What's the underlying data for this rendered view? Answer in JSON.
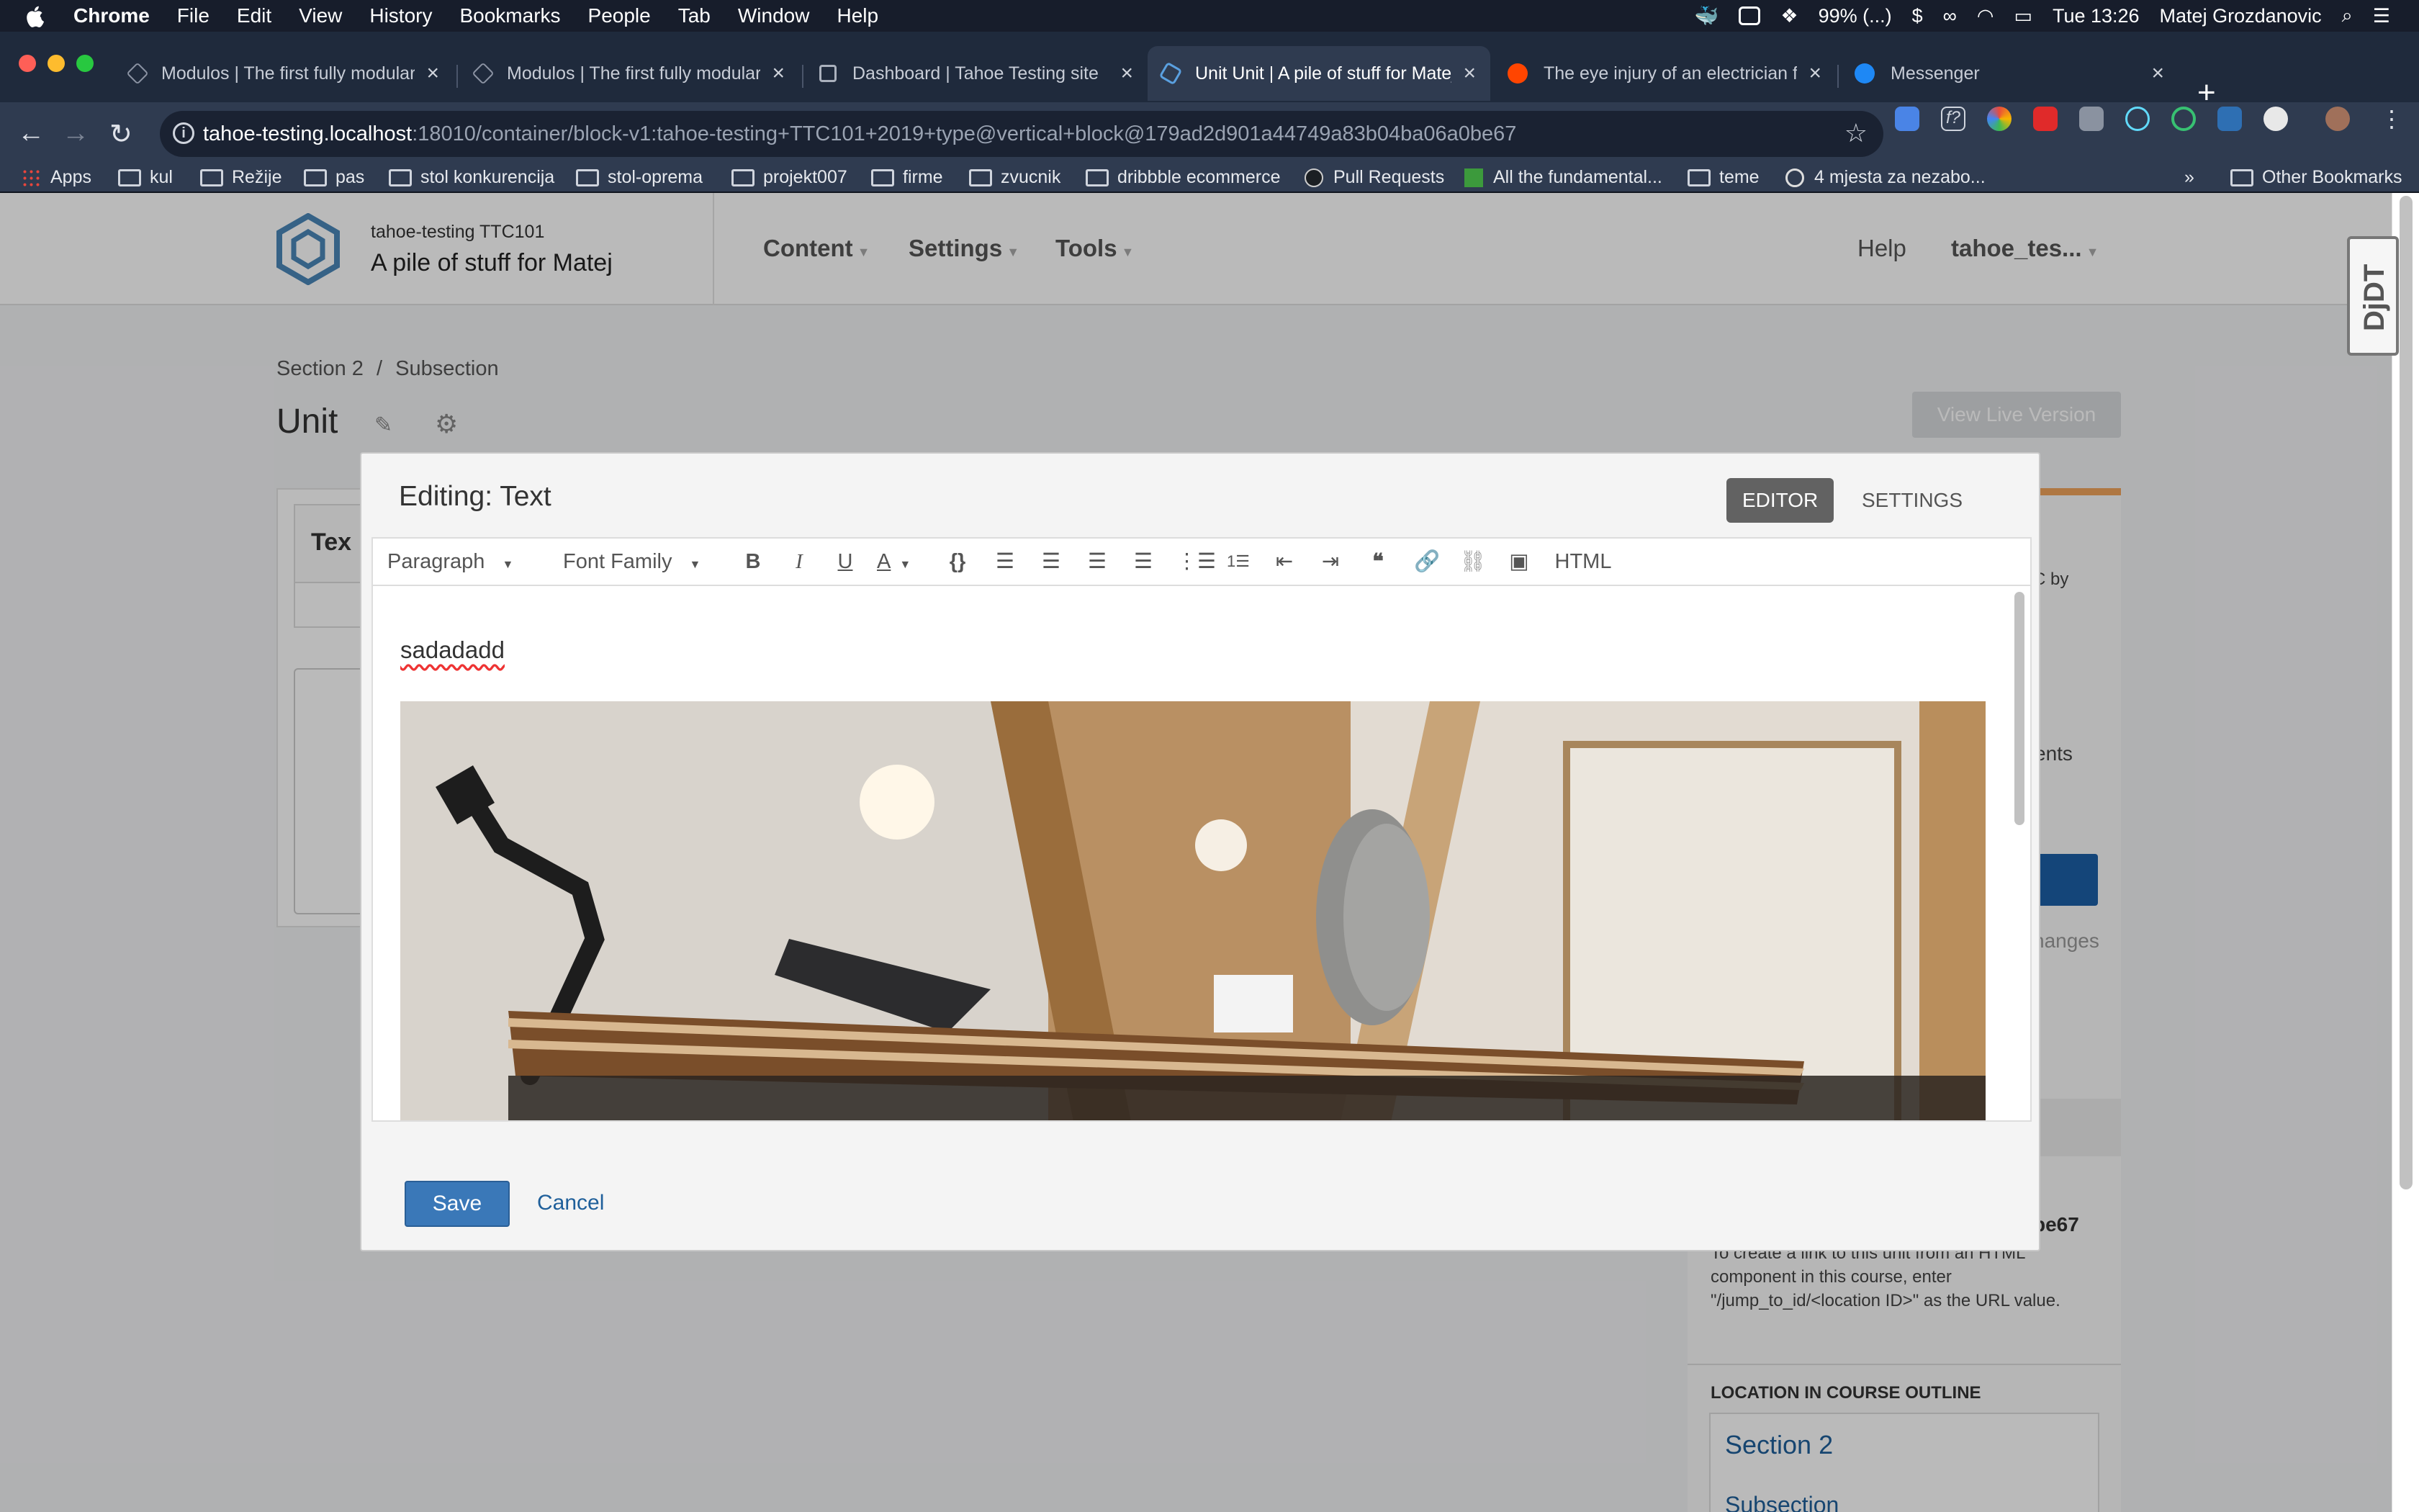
{
  "menubar": {
    "app": "Chrome",
    "items": [
      "File",
      "Edit",
      "View",
      "History",
      "Bookmarks",
      "People",
      "Tab",
      "Window",
      "Help"
    ],
    "battery": "99% (...)",
    "clock": "Tue 13:26",
    "user": "Matej Grozdanovic"
  },
  "tabs": [
    {
      "title": "Modulos | The first fully modular",
      "icon": "modulos-icon"
    },
    {
      "title": "Modulos | The first fully modular",
      "icon": "modulos-icon"
    },
    {
      "title": "Dashboard | Tahoe Testing site",
      "icon": "page-icon"
    },
    {
      "title": "Unit Unit | A pile of stuff for Matej",
      "icon": "openedx-icon",
      "active": true
    },
    {
      "title": "The eye injury of an electrician for",
      "icon": "reddit-icon"
    },
    {
      "title": "Messenger",
      "icon": "messenger-icon"
    }
  ],
  "address": {
    "host": "tahoe-testing.localhost",
    "path": ":18010/container/block-v1:tahoe-testing+TTC101+2019+type@vertical+block@179ad2d901a44749a83b04ba06a0be67"
  },
  "bookmarks": [
    "Apps",
    "kul",
    "Režije",
    "pas",
    "stol konkurencija",
    "stol-oprema",
    "projekt007",
    "firme",
    "zvucnik",
    "dribbble ecommerce",
    "Pull Requests",
    "All the fundamental...",
    "teme",
    "4 mjesta za nezabo..."
  ],
  "bookmarks_overflow": "»",
  "other_bookmarks": "Other Bookmarks",
  "course": {
    "org_number": "tahoe-testing  TTC101",
    "name": "A pile of stuff for Matej"
  },
  "header_nav": [
    "Content",
    "Settings",
    "Tools"
  ],
  "header_right": {
    "help": "Help",
    "user": "tahoe_tes..."
  },
  "breadcrumb": {
    "section": "Section 2",
    "sep": "/",
    "subsection": "Subsection"
  },
  "unit_title": "Unit",
  "view_live": "View Live Version",
  "component_partial": "Tex",
  "modal": {
    "title": "Editing: Text",
    "tab_editor": "EDITOR",
    "tab_settings": "SETTINGS",
    "toolbar": {
      "format": "Paragraph",
      "font": "Font Family",
      "html": "HTML"
    },
    "content_text": "sadadadd",
    "save": "Save",
    "cancel": "Cancel"
  },
  "sidebar": {
    "frag1": "C by",
    "frag2": "ents",
    "frag3": "hanges",
    "location_id_tail": "be67",
    "location_help": "To create a link to this unit from an HTML component in this course, enter \"/jump_to_id/<location ID>\" as the URL value.",
    "outline_heading": "LOCATION IN COURSE OUTLINE",
    "outline_section": "Section 2",
    "outline_subsection": "Subsection"
  },
  "ddt_label": "DjDT",
  "colors": {
    "accent": "#3a78b8",
    "menubar": "#171d2b",
    "tabbar": "#1f2a3c"
  }
}
